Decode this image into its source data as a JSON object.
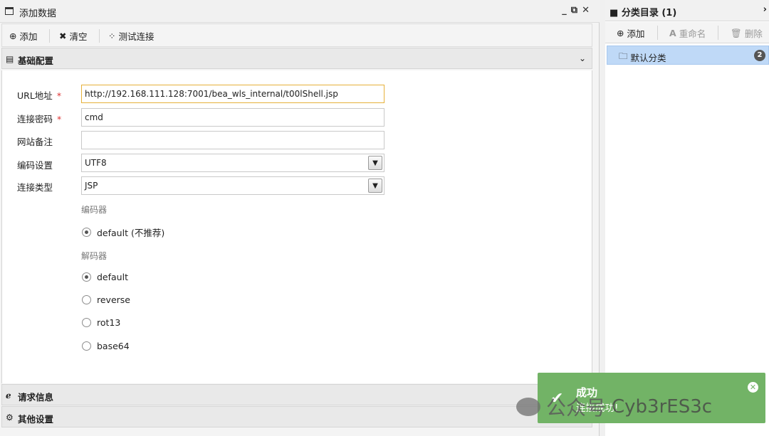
{
  "dialog": {
    "title": "添加数据",
    "win_min": "_",
    "win_max": "⧉",
    "win_close": "✕"
  },
  "toolbar": {
    "add_label": "添加",
    "clear_label": "清空",
    "test_label": "测试连接"
  },
  "sections": {
    "basic": "基础配置",
    "request": "请求信息",
    "other": "其他设置"
  },
  "form": {
    "url_label": "URL地址",
    "url_value": "http://192.168.111.128:7001/bea_wls_internal/t00lShell.jsp",
    "password_label": "连接密码",
    "password_value": "cmd",
    "note_label": "网站备注",
    "note_value": "",
    "encoding_label": "编码设置",
    "encoding_value": "UTF8",
    "type_label": "连接类型",
    "type_value": "JSP",
    "required_mark": "*",
    "encoder_group": "编码器",
    "encoders": [
      {
        "label": "default (不推荐)",
        "checked": true
      }
    ],
    "decoder_group": "解码器",
    "decoders": [
      {
        "label": "default",
        "checked": true
      },
      {
        "label": "reverse",
        "checked": false
      },
      {
        "label": "rot13",
        "checked": false
      },
      {
        "label": "base64",
        "checked": false
      }
    ]
  },
  "right_panel": {
    "title": "分类目录 (1)",
    "add_label": "添加",
    "rename_label": "重命名",
    "delete_label": "删除",
    "category_label": "默认分类",
    "category_count": "2"
  },
  "toast": {
    "title": "成功",
    "message": "连接成功!"
  },
  "watermark": {
    "text": "公众号",
    "handle": "Cyb3rES3c"
  },
  "colors": {
    "toast_bg": "#72b366",
    "selected_row": "#bfd9f7",
    "input_focus": "#e6b13a",
    "required": "#dd3333"
  }
}
